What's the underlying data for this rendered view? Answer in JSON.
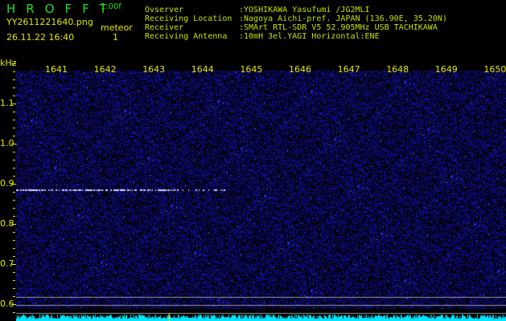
{
  "header": {
    "app_title": "HROFFT",
    "version": "1.00f",
    "filename": "YY2611221640.png",
    "datetime": "26.11.22 16:40",
    "mode_label": "meteor",
    "count": "1"
  },
  "info": [
    {
      "label": "Ovserver",
      "value": ":YOSHIKAWA Yasufumi /JG2MLI"
    },
    {
      "label": "Receiving Location",
      "value": ":Nagoya Aichi-pref. JAPAN (136.90E, 35.20N)"
    },
    {
      "label": "Receiver",
      "value": ":SMArt RTL-SDR V5 52.905MHz USB TACHIKAWA"
    },
    {
      "label": "Receiving Antenna",
      "value": ":10mH 3el.YAGI Horizontal:ENE"
    }
  ],
  "axis": {
    "unit": "kHz",
    "x_ticks": [
      "1641",
      "1642",
      "1643",
      "1644",
      "1645",
      "1646",
      "1647",
      "1648",
      "1649",
      "1650"
    ],
    "y_ticks": [
      "1.1",
      "1.0",
      "0.9",
      "0.8",
      "0.7",
      "0.6"
    ]
  },
  "colors": {
    "noise": "#2020c0",
    "trace": "#d0d0ff",
    "spectrum": "#00e5ff",
    "marker": "#ffff00"
  }
}
